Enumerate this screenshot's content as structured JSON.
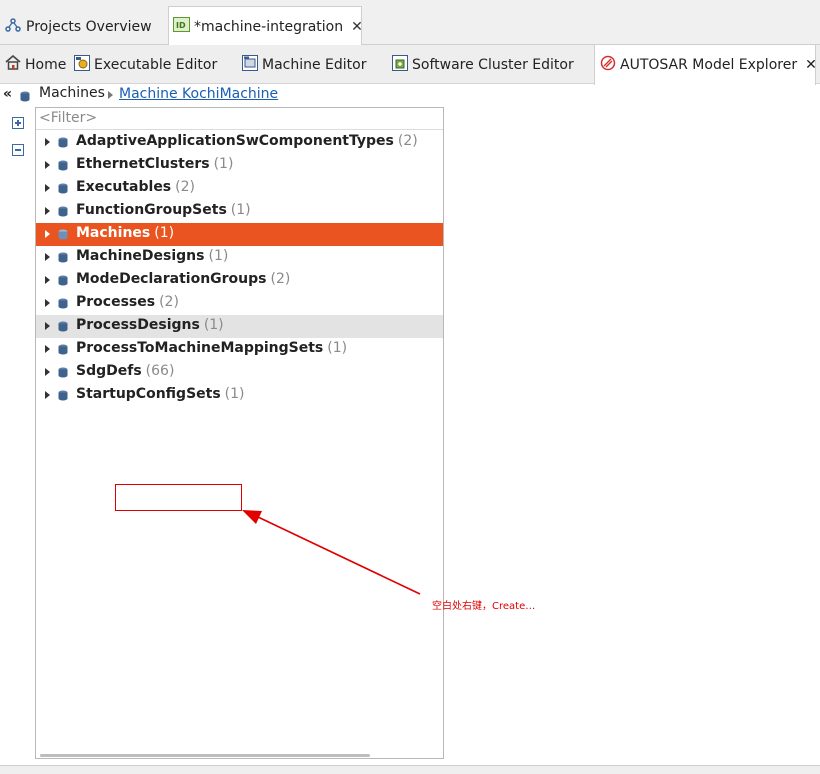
{
  "top_tabs": [
    {
      "label": "Projects Overview",
      "icon": "projects-overview-icon",
      "active": false
    },
    {
      "label": "*machine-integration",
      "icon": "integration-icon",
      "active": true,
      "closable": true
    }
  ],
  "sub_tabs": [
    {
      "label": "Home",
      "icon": "home-icon"
    },
    {
      "label": "Executable Editor",
      "icon": "executable-editor-icon"
    },
    {
      "label": "Machine Editor",
      "icon": "machine-editor-icon"
    },
    {
      "label": "Software Cluster Editor",
      "icon": "software-cluster-editor-icon"
    },
    {
      "label": "AUTOSAR Model Explorer",
      "icon": "autosar-icon",
      "active": true,
      "closable": true
    }
  ],
  "breadcrumb": {
    "root": "Machines",
    "link": "Machine KochiMachine"
  },
  "filter": {
    "placeholder": "<Filter>"
  },
  "tree": [
    {
      "label": "AdaptiveApplicationSwComponentTypes",
      "count": "(2)"
    },
    {
      "label": "EthernetClusters",
      "count": "(1)"
    },
    {
      "label": "Executables",
      "count": "(2)"
    },
    {
      "label": "FunctionGroupSets",
      "count": "(1)"
    },
    {
      "label": "Machines",
      "count": "(1)",
      "selected": true
    },
    {
      "label": "MachineDesigns",
      "count": "(1)"
    },
    {
      "label": "ModeDeclarationGroups",
      "count": "(2)"
    },
    {
      "label": "Processes",
      "count": "(2)"
    },
    {
      "label": "ProcessDesigns",
      "count": "(1)",
      "hover": true
    },
    {
      "label": "ProcessToMachineMappingSets",
      "count": "(1)"
    },
    {
      "label": "SdgDefs",
      "count": "(66)"
    },
    {
      "label": "StartupConfigSets",
      "count": "(1)"
    }
  ],
  "annotation": {
    "text": "空白处右键，Create…"
  },
  "colors": {
    "selection": "#e95420",
    "annotation": "#e00000",
    "link": "#1a5fb4"
  }
}
